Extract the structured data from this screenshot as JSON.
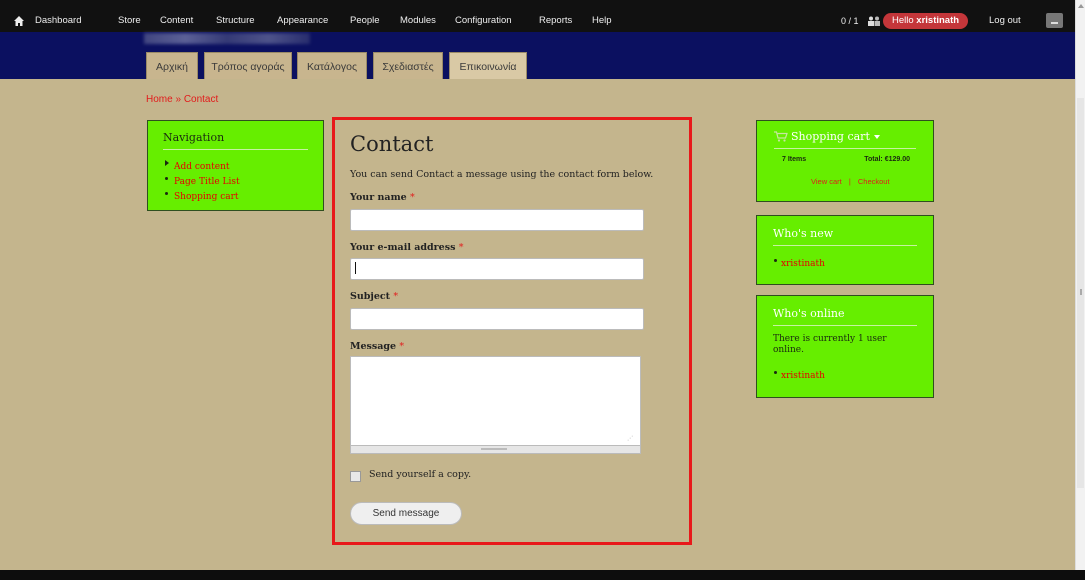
{
  "toolbar": {
    "items": [
      "Dashboard",
      "Store",
      "Content",
      "Structure",
      "Appearance",
      "People",
      "Modules",
      "Configuration",
      "Reports",
      "Help"
    ],
    "user_count": "0 / 1",
    "hello_prefix": "Hello ",
    "username": "xristinath",
    "logout": "Log out"
  },
  "header": {
    "tabs": [
      "Αρχική",
      "Τρόπος αγοράς",
      "Κατάλογος",
      "Σχεδιαστές",
      "Επικοινωνία"
    ]
  },
  "breadcrumb": {
    "home": "Home",
    "separator": " » ",
    "current": "Contact"
  },
  "navigation": {
    "title": "Navigation",
    "items": [
      "Add content",
      "Page Title List",
      "Shopping cart"
    ]
  },
  "contact": {
    "title": "Contact",
    "intro": "You can send Contact a message using the contact form below.",
    "name_label": "Your name",
    "email_label": "Your e-mail address",
    "subject_label": "Subject",
    "message_label": "Message",
    "required_mark": "*",
    "copy_label": "Send yourself a copy.",
    "send_button": "Send message"
  },
  "cart": {
    "title": "Shopping cart",
    "items": "7 Items",
    "total": "Total: €129.00",
    "view_cart": "View cart",
    "separator": "|",
    "checkout": "Checkout"
  },
  "whos_new": {
    "title": "Who's new",
    "users": [
      "xristinath"
    ]
  },
  "whos_online": {
    "title": "Who's online",
    "text": "There is currently 1 user online.",
    "users": [
      "xristinath"
    ]
  },
  "colors": {
    "toolbar_bg": "#111111",
    "header_bg": "#0b1060",
    "page_bg": "#c4b58d",
    "block_bg": "#66ee00",
    "link": "#e21b1b",
    "highlight_border": "#e8181a",
    "hello_badge": "#c4363a"
  }
}
